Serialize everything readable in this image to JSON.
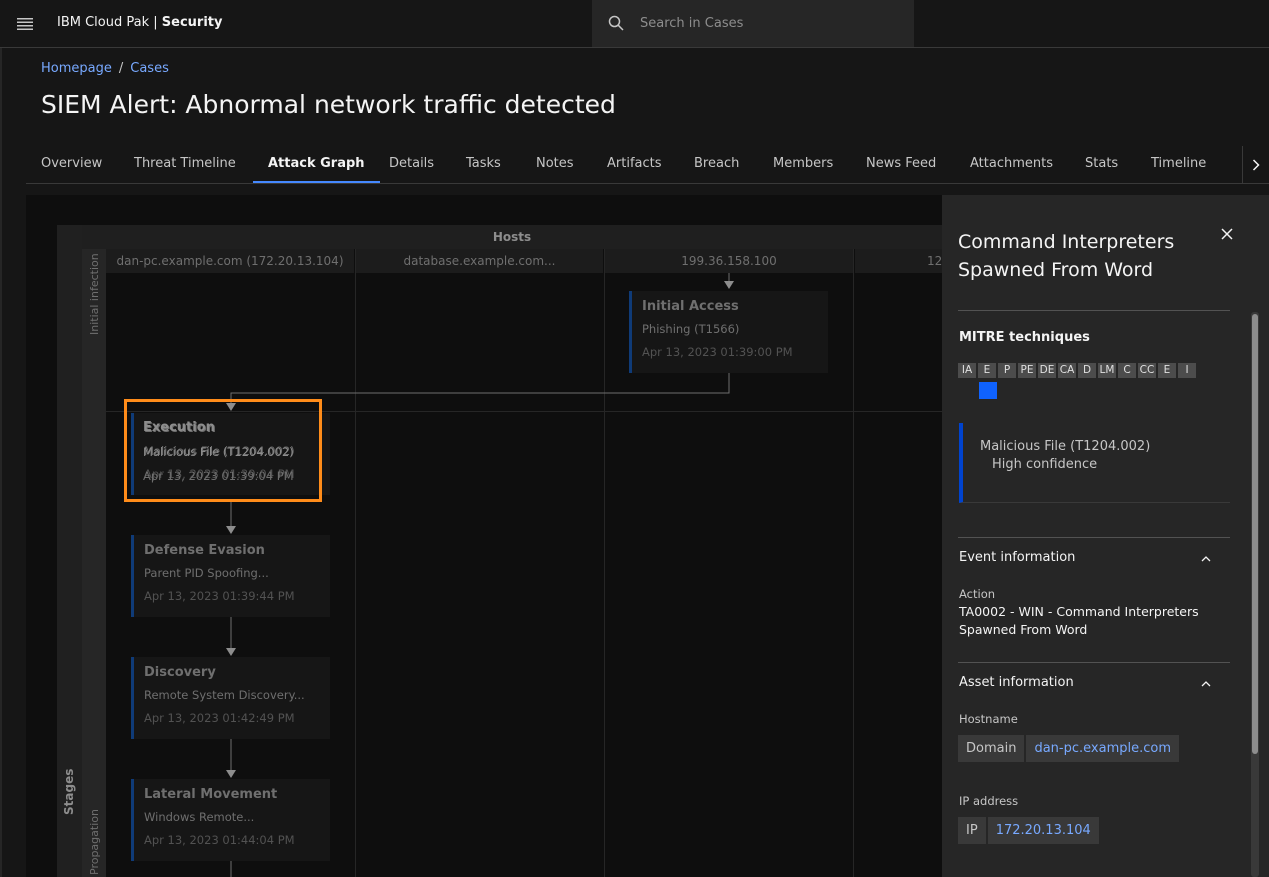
{
  "header": {
    "brand_prefix": "IBM Cloud Pak | ",
    "brand_product": "Security",
    "search_placeholder": "Search in Cases"
  },
  "breadcrumb": {
    "items": [
      "Homepage",
      "Cases"
    ],
    "separator": "/"
  },
  "page_title": "SIEM Alert: Abnormal network traffic detected",
  "tabs": [
    {
      "label": "Overview"
    },
    {
      "label": "Threat Timeline"
    },
    {
      "label": "Attack Graph",
      "active": true
    },
    {
      "label": "Details"
    },
    {
      "label": "Tasks"
    },
    {
      "label": "Notes"
    },
    {
      "label": "Artifacts"
    },
    {
      "label": "Breach"
    },
    {
      "label": "Members"
    },
    {
      "label": "News Feed"
    },
    {
      "label": "Attachments"
    },
    {
      "label": "Stats"
    },
    {
      "label": "Timeline"
    }
  ],
  "graph": {
    "stages_label": "Stages",
    "hosts_label": "Hosts",
    "rows": [
      "Initial infection",
      "Propagation"
    ],
    "hosts": [
      "dan-pc.example.com (172.20.13.104)",
      "database.example.com...",
      "199.36.158.100",
      "12"
    ],
    "nodes": [
      {
        "title": "Initial Access",
        "subtitle": "Phishing (T1566)",
        "date": "Apr 13, 2023 01:39:00 PM"
      },
      {
        "title": "Execution",
        "subtitle": "Malicious File (T1204.002)",
        "date": "Apr 13, 2023 01:39:04 PM"
      },
      {
        "title": "Defense Evasion",
        "subtitle": "Parent PID Spoofing...",
        "date": "Apr 13, 2023 01:39:44 PM"
      },
      {
        "title": "Discovery",
        "subtitle": "Remote System Discovery...",
        "date": "Apr 13, 2023 01:42:49 PM"
      },
      {
        "title": "Lateral Movement",
        "subtitle": "Windows Remote...",
        "date": "Apr 13, 2023 01:44:04 PM"
      }
    ]
  },
  "panel": {
    "title": "Command Interpreters Spawned From Word",
    "mitre_heading": "MITRE techniques",
    "mitre_tactics": [
      "IA",
      "E",
      "P",
      "PE",
      "DE",
      "CA",
      "D",
      "LM",
      "C",
      "CC",
      "E",
      "I"
    ],
    "technique": {
      "name": "Malicious File (T1204.002)",
      "confidence": "High confidence"
    },
    "event_section": "Event information",
    "action_label": "Action",
    "action_value": "TA0002 - WIN - Command Interpreters Spawned From Word",
    "asset_section": "Asset information",
    "hostname_label": "Hostname",
    "hostname_key": "Domain",
    "hostname_value": "dan-pc.example.com",
    "ip_label": "IP address",
    "ip_key": "IP",
    "ip_value": "172.20.13.104"
  },
  "colors": {
    "accent": "#4589ff",
    "highlight": "#ff8c1a",
    "link": "#78a9ff",
    "selected_tactic": "#0f62fe"
  }
}
